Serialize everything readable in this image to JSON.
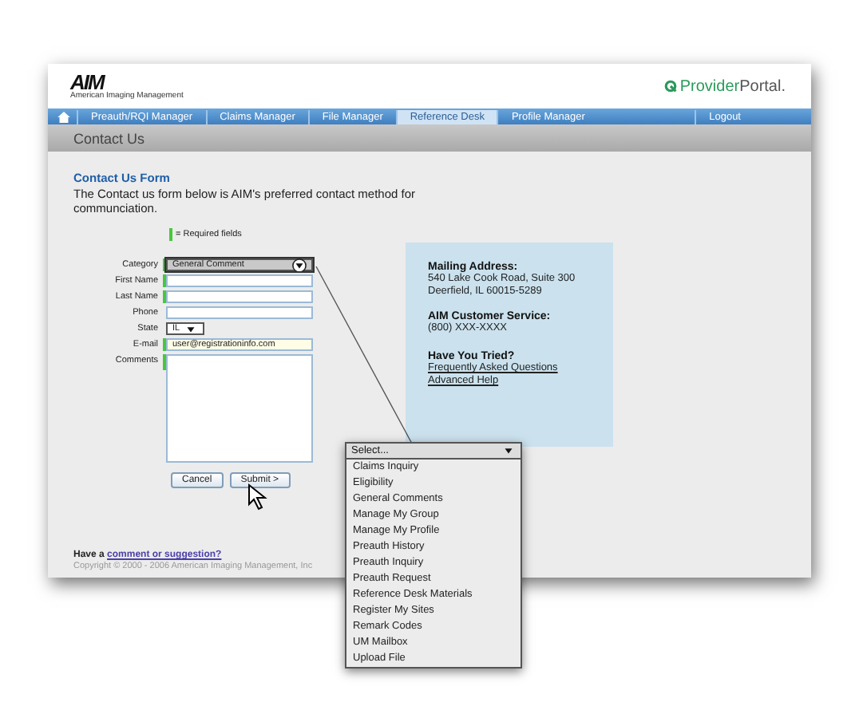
{
  "header": {
    "logo_text": "AIM",
    "logo_subtitle": "American Imaging Management",
    "portal_brand_bold": "Provider",
    "portal_brand_light": "Portal."
  },
  "nav": {
    "items": [
      {
        "label": "Preauth/RQI Manager",
        "selected": false
      },
      {
        "label": "Claims Manager",
        "selected": false
      },
      {
        "label": "File Manager",
        "selected": false
      },
      {
        "label": "Reference Desk",
        "selected": true
      },
      {
        "label": "Profile Manager",
        "selected": false
      }
    ],
    "logout": "Logout"
  },
  "page_title": "Contact Us",
  "form": {
    "title": "Contact Us Form",
    "intro": "The Contact us form below is AIM's preferred contact method for communciation.",
    "required_legend": "= Required fields",
    "fields": [
      {
        "label": "Category",
        "kind": "select",
        "value": "General Comment",
        "required": true,
        "highlighted": true
      },
      {
        "label": "First Name",
        "kind": "text",
        "required": true
      },
      {
        "label": "Last Name",
        "kind": "text",
        "required": true
      },
      {
        "label": "Phone",
        "kind": "text",
        "required": false
      },
      {
        "label": "State",
        "kind": "small_select",
        "value": "IL",
        "required": false
      },
      {
        "label": "E-mail",
        "kind": "text",
        "value": "user@registrationinfo.com",
        "required": true
      },
      {
        "label": "Comments",
        "kind": "textarea",
        "required": true
      }
    ],
    "buttons": [
      "Cancel",
      "Submit >"
    ]
  },
  "info_panel": {
    "mailing_heading": "Mailing Address:",
    "address_lines": [
      "540 Lake Cook Road, Suite 300",
      "Deerfield, IL 60015-5289"
    ],
    "service_heading": "AIM Customer Service:",
    "phone": "(800) XXX-XXXX",
    "tried_heading": "Have You Tried?",
    "links": [
      "Frequently Asked Questions",
      "Advanced Help"
    ]
  },
  "footer": {
    "prompt": "Have a",
    "link": "comment or suggestion?",
    "copyright": "Copyright © 2000 - 2006 American Imaging Management, Inc"
  },
  "dropdown_callout": {
    "value": "Select...",
    "options": [
      "Claims Inquiry",
      "Eligibility",
      "General Comments",
      "Manage My Group",
      "Manage My Profile",
      "Preauth History",
      "Preauth Inquiry",
      "Preauth Request",
      "Reference Desk Materials",
      "Register My Sites",
      "Remark Codes",
      "UM Mailbox",
      "Upload File"
    ]
  }
}
